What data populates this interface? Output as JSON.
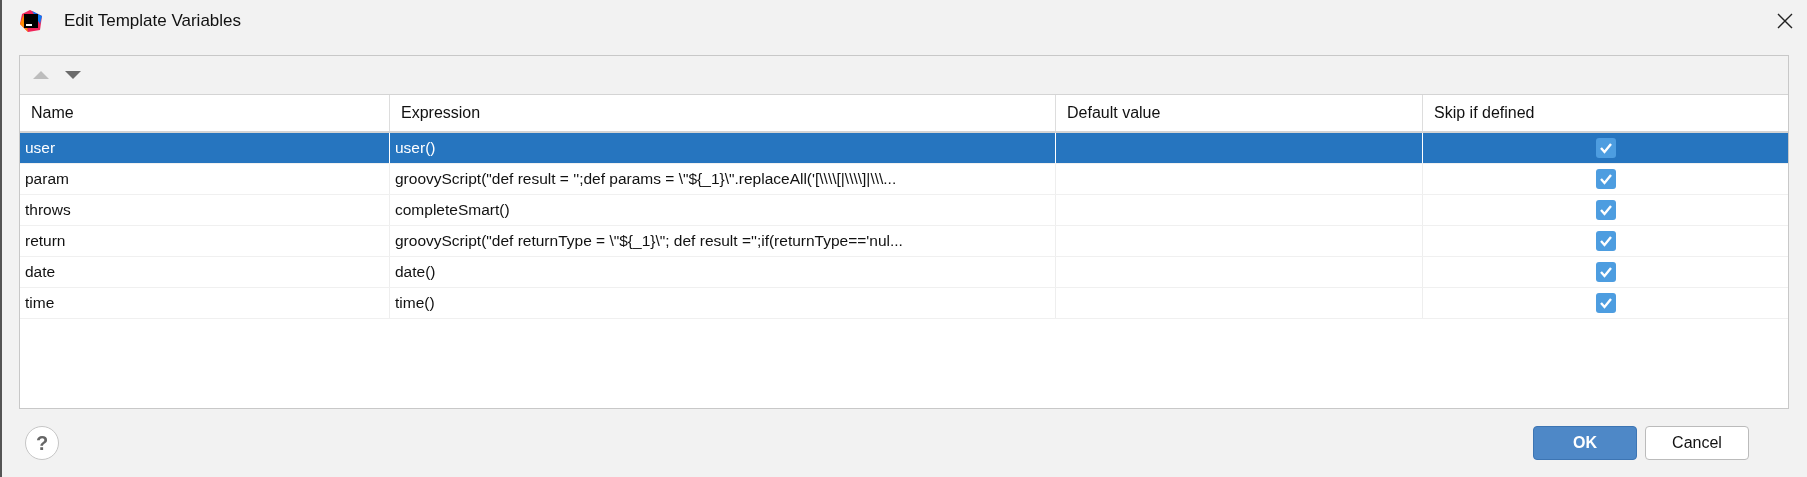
{
  "window": {
    "title": "Edit Template Variables"
  },
  "toolbar": [
    {
      "kind": "up",
      "disabled": true
    },
    {
      "kind": "down",
      "disabled": false
    }
  ],
  "table": {
    "columns": [
      "Name",
      "Expression",
      "Default value",
      "Skip if defined"
    ],
    "rows": [
      {
        "name": "user",
        "expression": "user()",
        "skip_if_defined": true,
        "selected": true
      },
      {
        "name": "param",
        "expression": "groovyScript(\"def result = '';def params = \\\"${_1}\\\".replaceAll('[\\\\\\\\[|\\\\\\\\]|\\\\\\...",
        "skip_if_defined": true,
        "selected": false
      },
      {
        "name": "throws",
        "expression": "completeSmart()",
        "skip_if_defined": true,
        "selected": false
      },
      {
        "name": "return",
        "expression": "groovyScript(\"def returnType = \\\"${_1}\\\"; def result ='';if(returnType=='nul...",
        "skip_if_defined": true,
        "selected": false
      },
      {
        "name": "date",
        "expression": "date()",
        "skip_if_defined": true,
        "selected": false
      },
      {
        "name": "time",
        "expression": "time()",
        "skip_if_defined": true,
        "selected": false
      }
    ]
  },
  "footer": {
    "help": "?",
    "buttons": [
      {
        "label": "OK",
        "kind": "primary"
      },
      {
        "label": "Cancel",
        "kind": "secondary"
      }
    ]
  }
}
